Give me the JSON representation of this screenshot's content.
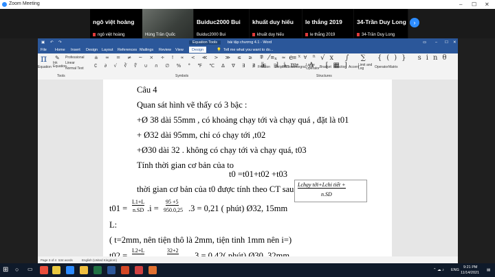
{
  "zoom": {
    "title": "Zoom Meeting"
  },
  "participants": [
    {
      "name_big": "ngô việt hoàng",
      "name_small": "ngô việt hoàng",
      "muted": true
    },
    {
      "name_big": "",
      "name_small": "Hùng Trần Quốc",
      "muted": false,
      "video": true
    },
    {
      "name_big": "Buiduc2000 Bui",
      "name_small": "Buiduc2000 Bui",
      "muted": false
    },
    {
      "name_big": "khuất duy hiếu",
      "name_small": "khuất duy hiếu",
      "muted": true
    },
    {
      "name_big": "le thắng 2019",
      "name_small": "le thắng 2019",
      "muted": true
    },
    {
      "name_big": "34-Trần Duy Long",
      "name_small": "34-Trần Duy Long",
      "muted": true
    }
  ],
  "word": {
    "contextual": "Equation Tools",
    "doc_title": "bài tập chương 4.1 - Word",
    "tabs": [
      "File",
      "Home",
      "Insert",
      "Design",
      "Layout",
      "References",
      "Mailings",
      "Review",
      "View",
      "Design"
    ],
    "tell_me": "Tell me what you want to do...",
    "ribbon": {
      "equation": "Equation",
      "ink_equation": "Ink Equation",
      "professional": "Professional",
      "linear": "Linear",
      "normal_text": "Normal Text",
      "tools_group": "Tools",
      "symbols_group": "Symbols",
      "structures_group": "Structures",
      "structures": [
        "Fraction",
        "Script",
        "Radical",
        "Integral",
        "Large Operator",
        "Bracket",
        "Function",
        "Accent",
        "Limit and Log",
        "Operator",
        "Matrix"
      ]
    },
    "status": {
      "page": "Page 3 of 4",
      "words": "534 words",
      "language": "English (United Kingdom)"
    }
  },
  "doc": {
    "l1": "Câu 4",
    "l2": "Quan sát hình vẽ thấy có 3 bậc :",
    "l3": "+Ø 38 dài 55mm , có khoảng chạy tới và chạy quá , đặt là t01",
    "l4": "+ Ø32 dài 95mm, chỉ có chạy tới ,t02",
    "l5": "+Ø30  dài 32 . không có chạy tới và chạy quá, t03",
    "l6": " Tính thời gian cơ bản của to",
    "l7": "t0 =t01+t02 +t03",
    "l8": "thời gian cơ bản của t0 được tính theo CT sau : t0 =",
    "formula_num": "Lchạy tới+Lchi tiết +",
    "formula_den": "n.SD",
    "l9a": "t01 =",
    "l9_frac1_num": "L1+L",
    "l9_frac1_den": "n.SD",
    "l9_i": ".i =",
    "l9_frac2_num": "95 +5",
    "l9_frac2_den": "950.0,25",
    "l9_rest": ".3 = 0,21 ( phút)  Ø32, 15mm",
    "l10": "L:",
    "l11": "( t=2mm, nên tiện thô là 2mm, tiện tinh 1mm nên i=)",
    "l12a": "t02 =",
    "l12_frac1_num": "L2+L",
    "l12_frac2_num": "32+2",
    "l12_rest": ".3 = 0,42( phút)   Ø30, 32mm"
  },
  "taskbar": {
    "lang": "ENG",
    "time": "9:21 PM",
    "date": "11/14/2021"
  }
}
